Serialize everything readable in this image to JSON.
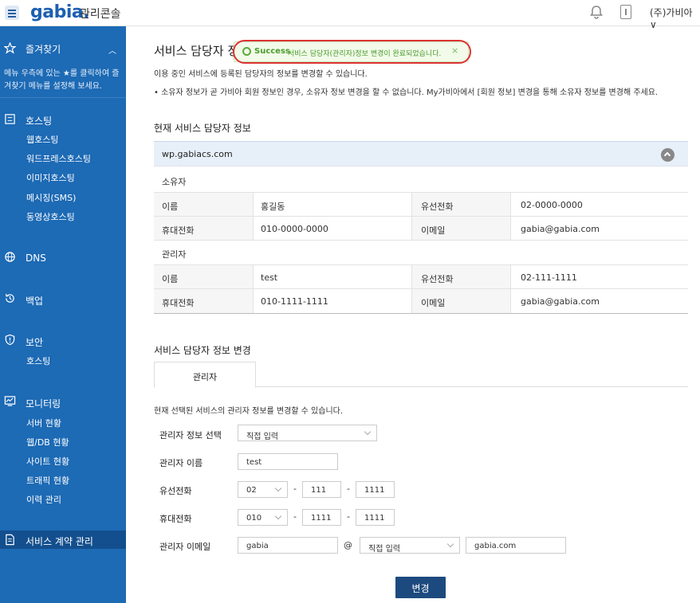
{
  "header": {
    "logo": "gabia.",
    "title": "관리콘솔",
    "user": "(주)가비아 ∨"
  },
  "sidebar": {
    "favorites": {
      "label": "즐겨찾기",
      "desc": "메뉴 우측에 있는 ★를 클릭하여 즐겨찾기 메뉴를 설정해 보세요."
    },
    "hosting": {
      "label": "호스팅",
      "items": [
        "웹호스팅",
        "워드프레스호스팅",
        "이미지호스팅",
        "메시징(SMS)",
        "동영상호스팅"
      ]
    },
    "dns": {
      "label": "DNS"
    },
    "backup": {
      "label": "백업"
    },
    "security": {
      "label": "보안",
      "items": [
        "호스팅"
      ]
    },
    "monitoring": {
      "label": "모니터링",
      "items": [
        "서버 현황",
        "웹/DB 현황",
        "사이트 현황",
        "트래픽 현황",
        "이력 관리"
      ]
    },
    "contract": {
      "label": "서비스 계약 관리"
    }
  },
  "page": {
    "title": "서비스 담당자 정",
    "desc1": "이용 중인 서비스에 등록된 담당자의 정보를 변경할 수 있습니다.",
    "desc2": "•  소유자 정보가 곧 가비아 회원 정보인 경우, 소유자 정보 변경을 할 수 없습니다. My가비아에서 [회원 정보] 변경을 통해 소유자 정보를 변경해 주세요.",
    "section_current": "현재 서비스 담당자 정보",
    "section_change": "서비스 담당자 정보 변경",
    "change_desc": "현재 선택된 서비스의 관리자 정보를 변경할 수 있습니다.",
    "submit_label": "변경"
  },
  "toast": {
    "status": "Success",
    "message": "서비스 담당자(관리자)정보 변경이 완료되었습니다.",
    "close": "×"
  },
  "current_info": {
    "domain": "wp.gabiacs.com",
    "owner": {
      "title": "소유자",
      "name_label": "이름",
      "name": "홍길동",
      "tel_label": "유선전화",
      "tel": "02-0000-0000",
      "mobile_label": "휴대전화",
      "mobile": "010-0000-0000",
      "email_label": "이메일",
      "email": "gabia@gabia.com"
    },
    "admin": {
      "title": "관리자",
      "name_label": "이름",
      "name": "test",
      "tel_label": "유선전화",
      "tel": "02-111-1111",
      "mobile_label": "휴대전화",
      "mobile": "010-1111-1111",
      "email_label": "이메일",
      "email": "gabia@gabia.com"
    }
  },
  "form": {
    "tab": "관리자",
    "select_label": "관리자 정보 선택",
    "select_value": "직접 입력",
    "name_label": "관리자 이름",
    "name_value": "test",
    "tel_label": "유선전화",
    "tel1": "02",
    "tel2": "111",
    "tel3": "1111",
    "mobile_label": "휴대전화",
    "mobile1": "010",
    "mobile2": "1111",
    "mobile3": "1111",
    "email_label": "관리자 이메일",
    "email_id": "gabia",
    "at": "@",
    "email_domain_select": "직접 입력",
    "email_domain": "gabia.com",
    "dash": "-"
  }
}
